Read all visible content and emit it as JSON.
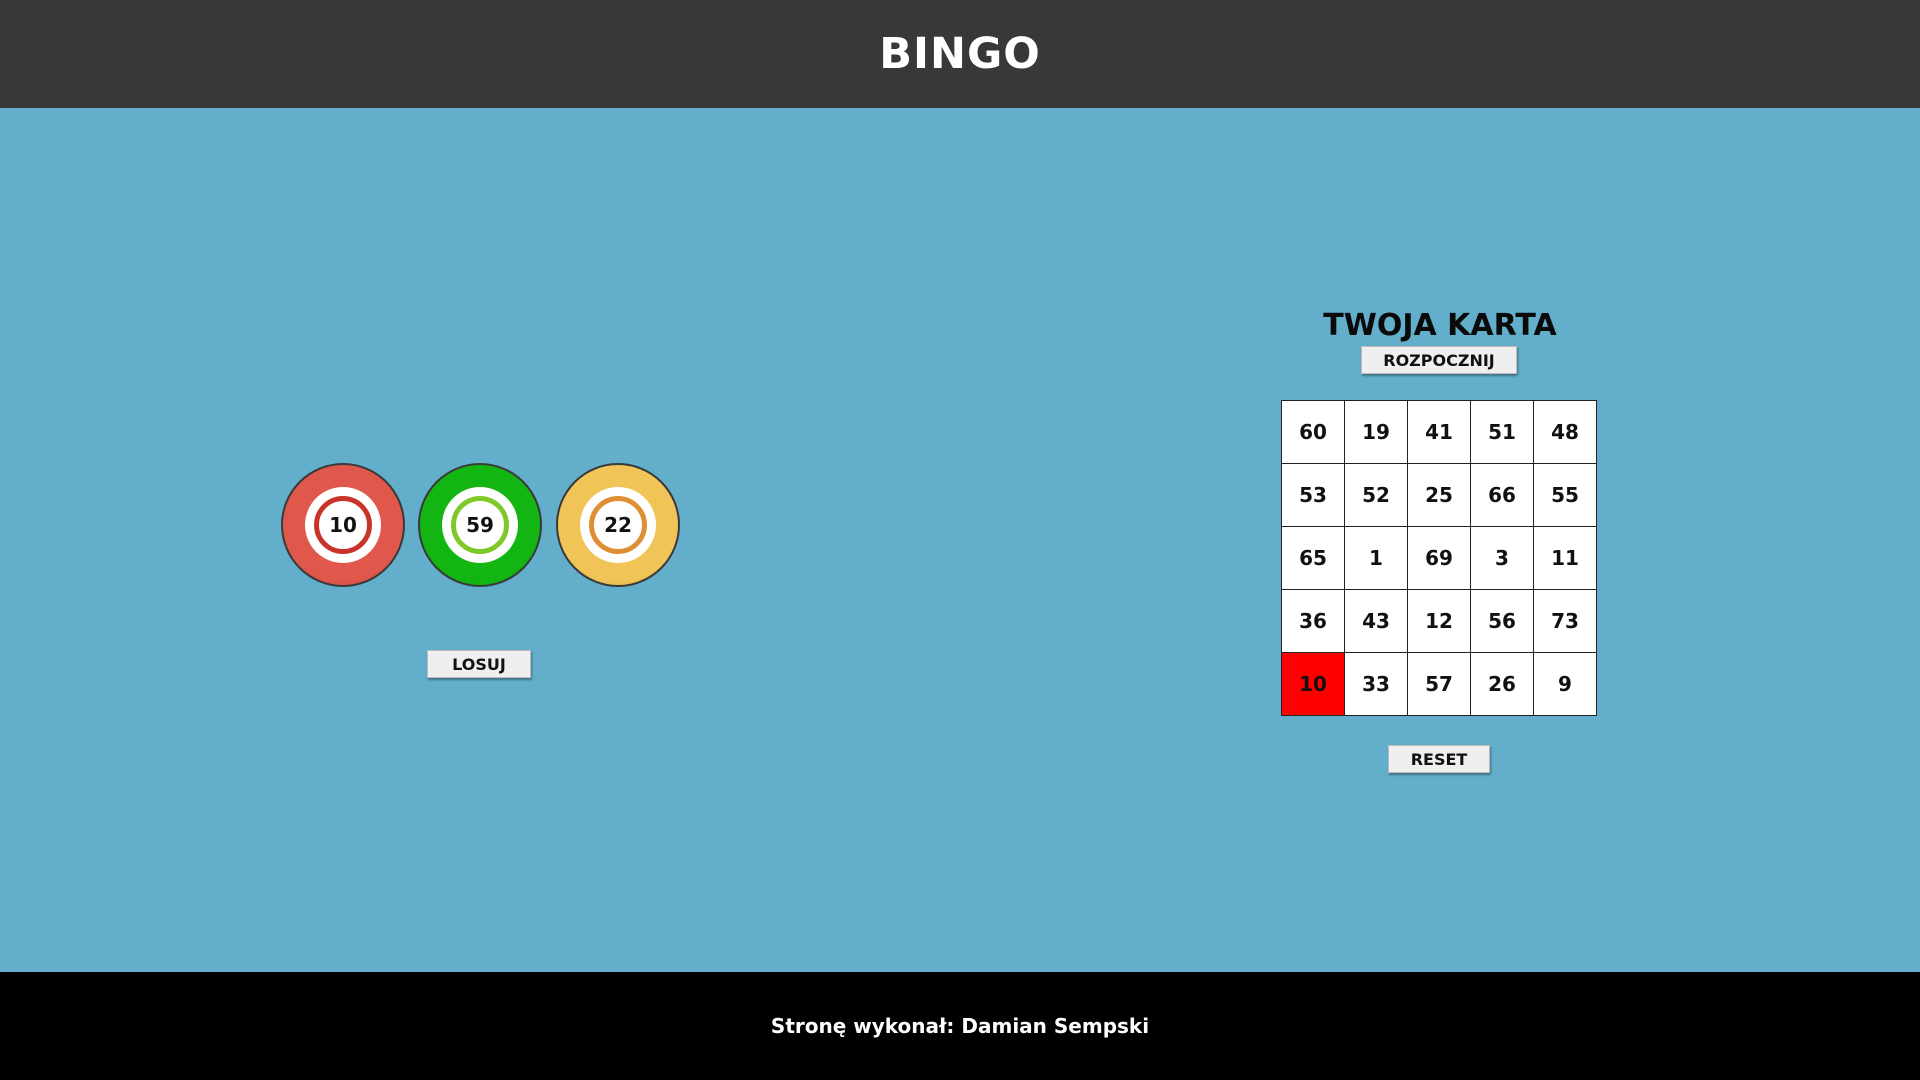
{
  "header": {
    "title": "BINGO"
  },
  "balls": [
    {
      "number": "10",
      "color": "#e0574c",
      "ring_color": "#c9342a"
    },
    {
      "number": "59",
      "color": "#12b512",
      "ring_color": "#7ec82a"
    },
    {
      "number": "22",
      "color": "#f0c456",
      "ring_color": "#de8f33"
    }
  ],
  "draw_button": {
    "label": "LOSUJ"
  },
  "card": {
    "title": "TWOJA KARTA",
    "start_label": "ROZPOCZNIJ",
    "reset_label": "RESET",
    "marked_color": "#ff0000",
    "rows": [
      [
        "60",
        "19",
        "41",
        "51",
        "48"
      ],
      [
        "53",
        "52",
        "25",
        "66",
        "55"
      ],
      [
        "65",
        "1",
        "69",
        "3",
        "11"
      ],
      [
        "36",
        "43",
        "12",
        "56",
        "73"
      ],
      [
        "10",
        "33",
        "57",
        "26",
        "9"
      ]
    ],
    "marked": [
      "10"
    ]
  },
  "footer": {
    "credit": "Stronę wykonał: Damian Sempski"
  }
}
